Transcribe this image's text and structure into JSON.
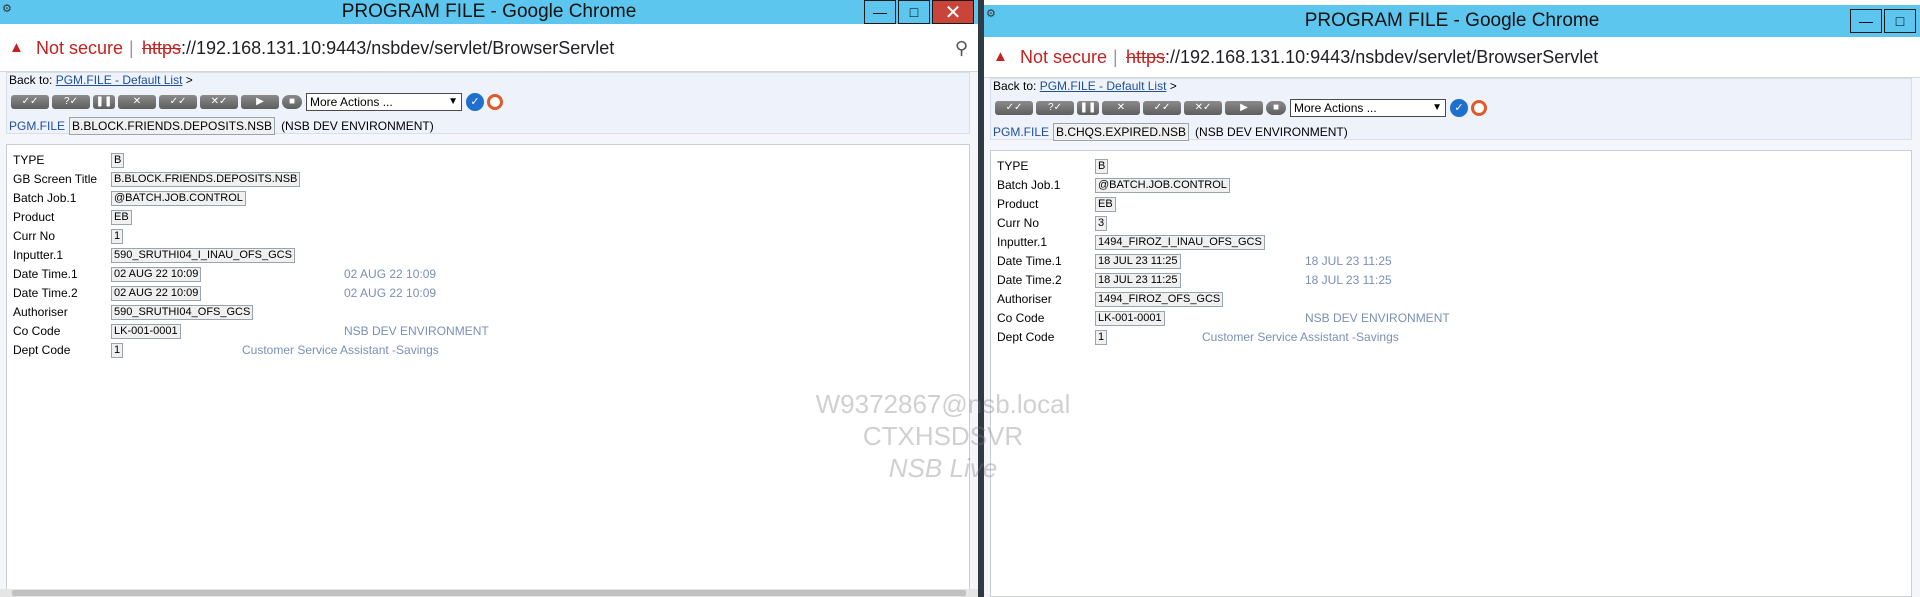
{
  "left": {
    "title": "PROGRAM FILE - Google Chrome",
    "not_secure": "Not secure",
    "url_scheme": "https",
    "url_rest": "://192.168.131.10:9443/nsbdev/servlet/BrowserServlet",
    "back_to_label": "Back to:",
    "back_to_link": "PGM.FILE - Default List",
    "back_to_arrow": ">",
    "more_actions": "More Actions ...",
    "app_name": "PGM.FILE",
    "record_id": "B.BLOCK.FRIENDS.DEPOSITS.NSB",
    "environment": "(NSB DEV ENVIRONMENT)",
    "fields": [
      {
        "label": "TYPE",
        "value": "B",
        "enrichment": ""
      },
      {
        "label": "GB Screen Title",
        "value": "B.BLOCK.FRIENDS.DEPOSITS.NSB",
        "enrichment": ""
      },
      {
        "label": "Batch Job.1",
        "value": "@BATCH.JOB.CONTROL",
        "enrichment": ""
      },
      {
        "label": "Product",
        "value": "EB",
        "enrichment": ""
      },
      {
        "label": "Curr No",
        "value": "1",
        "enrichment": ""
      },
      {
        "label": "Inputter.1",
        "value": "590_SRUTHI04_I_INAU_OFS_GCS",
        "enrichment": ""
      },
      {
        "label": "Date Time.1",
        "value": "02 AUG 22 10:09",
        "enrichment": "02 AUG 22 10:09"
      },
      {
        "label": "Date Time.2",
        "value": "02 AUG 22 10:09",
        "enrichment": "02 AUG 22 10:09"
      },
      {
        "label": "Authoriser",
        "value": "590_SRUTHI04_OFS_GCS",
        "enrichment": ""
      },
      {
        "label": "Co Code",
        "value": "LK-001-0001",
        "enrichment": "NSB DEV ENVIRONMENT"
      },
      {
        "label": "Dept Code",
        "value": "1",
        "enrichment": "Customer Service Assistant -Savings"
      }
    ]
  },
  "right": {
    "title": "PROGRAM FILE - Google Chrome",
    "not_secure": "Not secure",
    "url_scheme": "https",
    "url_rest": "://192.168.131.10:9443/nsbdev/servlet/BrowserServlet",
    "back_to_label": "Back to:",
    "back_to_link": "PGM.FILE - Default List",
    "back_to_arrow": ">",
    "more_actions": "More Actions ...",
    "app_name": "PGM.FILE",
    "record_id": "B.CHQS.EXPIRED.NSB",
    "environment": "(NSB DEV ENVIRONMENT)",
    "fields": [
      {
        "label": "TYPE",
        "value": "B",
        "enrichment": ""
      },
      {
        "label": "Batch Job.1",
        "value": "@BATCH.JOB.CONTROL",
        "enrichment": ""
      },
      {
        "label": "Product",
        "value": "EB",
        "enrichment": ""
      },
      {
        "label": "Curr No",
        "value": "3",
        "enrichment": ""
      },
      {
        "label": "Inputter.1",
        "value": "1494_FIROZ_I_INAU_OFS_GCS",
        "enrichment": ""
      },
      {
        "label": "Date Time.1",
        "value": "18 JUL 23 11:25",
        "enrichment": "18 JUL 23 11:25"
      },
      {
        "label": "Date Time.2",
        "value": "18 JUL 23 11:25",
        "enrichment": "18 JUL 23 11:25"
      },
      {
        "label": "Authoriser",
        "value": "1494_FIROZ_OFS_GCS",
        "enrichment": ""
      },
      {
        "label": "Co Code",
        "value": "LK-001-0001",
        "enrichment": "NSB DEV ENVIRONMENT"
      },
      {
        "label": "Dept Code",
        "value": "1",
        "enrichment": "Customer Service Assistant -Savings"
      }
    ]
  },
  "watermark": {
    "line1": "W9372867@nsb.local",
    "line2": "CTXHSDSVR",
    "line3": "NSB Live"
  },
  "icons": {
    "warning": "warning-triangle-icon",
    "zoom": "magnifier-icon",
    "minimize": "minimize-icon",
    "maximize": "maximize-icon",
    "close": "close-icon"
  },
  "colors": {
    "titlebar": "#5cc6ee",
    "not_secure": "#c5221f",
    "link": "#1f4f9b",
    "enrichment": "#7a8fb8"
  }
}
